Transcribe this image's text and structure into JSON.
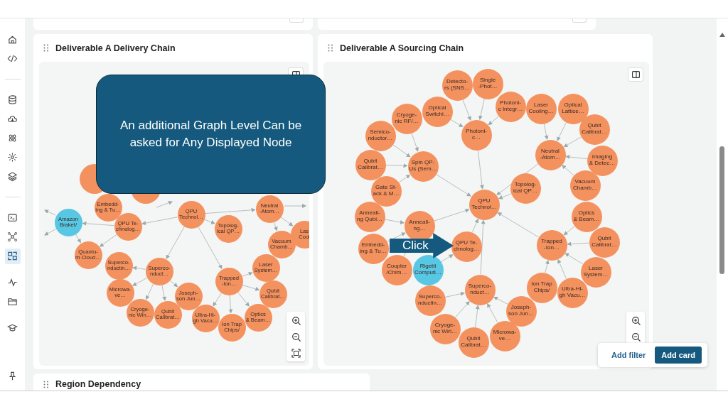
{
  "sidebar": {
    "items": [
      {
        "selected": false
      },
      {
        "selected": false
      },
      {
        "selected": false
      },
      {
        "selected": false
      },
      {
        "selected": false
      },
      {
        "selected": false
      },
      {
        "selected": false
      },
      {
        "selected": false
      },
      {
        "selected": false
      },
      {
        "selected": true
      },
      {
        "selected": false
      },
      {
        "selected": false
      },
      {
        "selected": false
      },
      {
        "selected": false
      }
    ]
  },
  "cards": [
    {
      "title": "Deliverable A Delivery Chain",
      "nodes": [
        {
          "label": "Embedd-\ning & Tu…",
          "color": "#f4925f"
        },
        {
          "label": "QPU\nTechnol…",
          "color": "#f4925f"
        },
        {
          "label": "Neutral\n-Atom…",
          "color": "#f4925f"
        },
        {
          "label": "Amazon\nBraket/",
          "color": "#57c7e3"
        },
        {
          "label": "QPU Te-\nchnolog…",
          "color": "#f4925f"
        },
        {
          "label": "Topolog-\nical QP…",
          "color": "#f4925f"
        },
        {
          "label": "Las\nCool",
          "color": "#f4925f"
        },
        {
          "label": "Quantu-\nm Cloud…",
          "color": "#f4925f"
        },
        {
          "label": "Vacuum\nChamb…",
          "color": "#f4925f"
        },
        {
          "label": "Superco-\nnductin…",
          "color": "#f4925f"
        },
        {
          "label": "Superco-\nnduct…",
          "color": "#f4925f"
        },
        {
          "label": "Laser\nSystem…",
          "color": "#f4925f"
        },
        {
          "label": "Microwa-\nve…",
          "color": "#f4925f"
        },
        {
          "label": "Joseph-\nson Jun…",
          "color": "#f4925f"
        },
        {
          "label": "Trapped\n-Ion…",
          "color": "#f4925f"
        },
        {
          "label": "Qubit\nCalibrat…",
          "color": "#f4925f"
        },
        {
          "label": "Cryoge-\nnic Win…",
          "color": "#f4925f"
        },
        {
          "label": "Qubit\nCalibrat…",
          "color": "#f4925f"
        },
        {
          "label": "Ultra-Hi-\ngh Vacu…",
          "color": "#f4925f"
        },
        {
          "label": "Ion Trap\nChips/",
          "color": "#f4925f"
        },
        {
          "label": "Optics\n& Beam…",
          "color": "#f4925f"
        }
      ]
    },
    {
      "title": "Deliverable A Sourcing Chain",
      "nodes": [
        {
          "label": "Detecto-\nrs (SNS…",
          "color": "#f4925f"
        },
        {
          "label": "Single\n-Phot…",
          "color": "#f4925f"
        },
        {
          "label": "Cryoge-\nnic RF/…",
          "color": "#f4925f"
        },
        {
          "label": "Optical\nSwitchi…",
          "color": "#f4925f"
        },
        {
          "label": "Photoni-\nc Integr…",
          "color": "#f4925f"
        },
        {
          "label": "Laser\nCooling…",
          "color": "#f4925f"
        },
        {
          "label": "Optical\nLattice…",
          "color": "#f4925f"
        },
        {
          "label": "Semico-\nnductor…",
          "color": "#f4925f"
        },
        {
          "label": "Photoni-\nc…",
          "color": "#f4925f"
        },
        {
          "label": "Qubit\nCalibrat…",
          "color": "#f4925f"
        },
        {
          "label": "Qubit\nCalibrat…",
          "color": "#f4925f"
        },
        {
          "label": "Spin QP-\nUs (Sem…",
          "color": "#f4925f"
        },
        {
          "label": "Neutral\n-Atom…",
          "color": "#f4925f"
        },
        {
          "label": "Imaging\n& Detec…",
          "color": "#f4925f"
        },
        {
          "label": "Gate St-\nack & M…",
          "color": "#f4925f"
        },
        {
          "label": "Topolog-\nical QP…",
          "color": "#f4925f"
        },
        {
          "label": "Vacuum\nChamb…",
          "color": "#f4925f"
        },
        {
          "label": "Anneali-\nng Qubi…",
          "color": "#f4925f"
        },
        {
          "label": "Anneali-\nng…",
          "color": "#f4925f"
        },
        {
          "label": "QPU\nTechnol…",
          "color": "#f4925f"
        },
        {
          "label": "Optics\n& Beam…",
          "color": "#f4925f"
        },
        {
          "label": "Embedd-\ning & Tu…",
          "color": "#f4925f"
        },
        {
          "label": "QPU Te-\nchnolog…",
          "color": "#f4925f"
        },
        {
          "label": "Trapped\n-Ion…",
          "color": "#f4925f"
        },
        {
          "label": "Qubit\nCalibrat…",
          "color": "#f4925f"
        },
        {
          "label": "Coupler\n/Chim…",
          "color": "#f4925f"
        },
        {
          "label": "Rigetti\nComputi…",
          "color": "#57c7e3"
        },
        {
          "label": "Laser\nSystem…",
          "color": "#f4925f"
        },
        {
          "label": "Superco-\nnductin…",
          "color": "#f4925f"
        },
        {
          "label": "Superco-\nnduct…",
          "color": "#f4925f"
        },
        {
          "label": "Ion Trap\nChips/",
          "color": "#f4925f"
        },
        {
          "label": "Ultra-Hi-\ngh Vacu…",
          "color": "#f4925f"
        },
        {
          "label": "Cryoge-\nnic Wiri…",
          "color": "#f4925f"
        },
        {
          "label": "Qubit\nCalibrat…",
          "color": "#f4925f"
        },
        {
          "label": "Microwa-\nve…",
          "color": "#f4925f"
        },
        {
          "label": "Joseph-\nson Jun…",
          "color": "#f4925f"
        }
      ]
    }
  ],
  "bottom_card": {
    "title": "Region Dependency"
  },
  "callout": {
    "text": "An additional Graph Level Can be asked for Any Displayed Node"
  },
  "click_arrow": {
    "label": "Click"
  },
  "actions": {
    "buttons": [
      "Add filter",
      "Add card"
    ]
  }
}
